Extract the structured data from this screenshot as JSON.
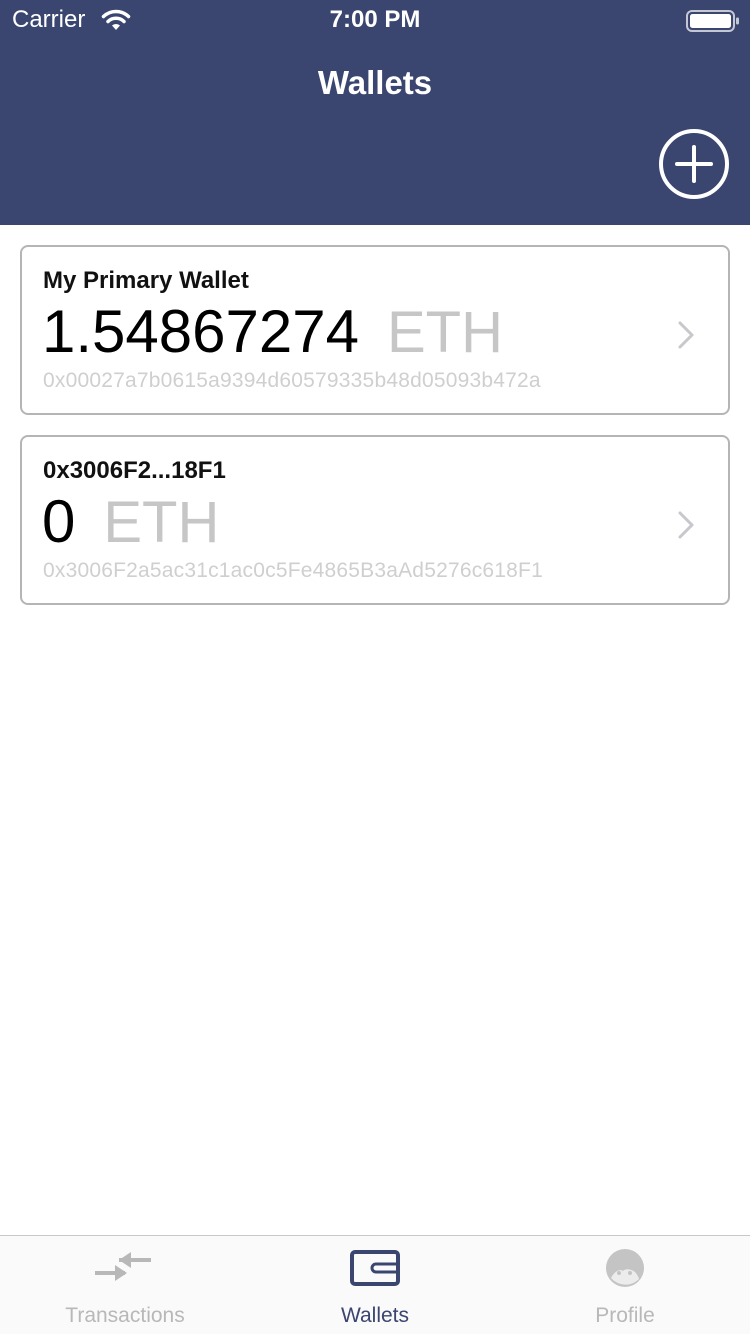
{
  "status_bar": {
    "carrier": "Carrier",
    "time": "7:00 PM"
  },
  "header": {
    "title": "Wallets",
    "add_icon": "plus-circle-icon"
  },
  "wallets": [
    {
      "name": "My Primary Wallet",
      "balance": "1.54867274",
      "currency": "ETH",
      "address": "0x00027a7b0615a9394d60579335b48d05093b472a"
    },
    {
      "name": "0x3006F2...18F1",
      "balance": "0",
      "currency": "ETH",
      "address": "0x3006F2a5ac31c1ac0c5Fe4865B3aAd5276c618F1"
    }
  ],
  "tabs": [
    {
      "label": "Transactions",
      "icon": "transactions-icon"
    },
    {
      "label": "Wallets",
      "icon": "wallet-icon",
      "active": true
    },
    {
      "label": "Profile",
      "icon": "profile-icon"
    }
  ],
  "colors": {
    "header": "#3a4570",
    "accent": "#3a4570",
    "inactive": "#b8b8b8",
    "muted": "#c6c6c6"
  }
}
